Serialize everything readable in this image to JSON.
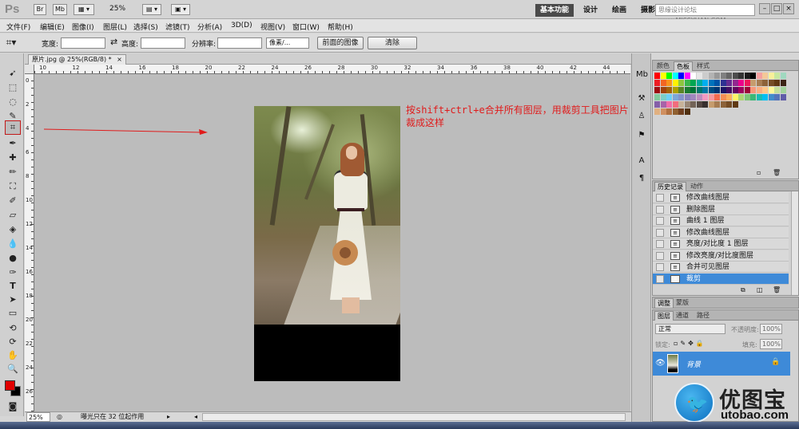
{
  "app": {
    "logo": "Ps",
    "top_buttons": [
      "Br",
      "Mb"
    ],
    "zoom_select": "25%",
    "workspaces": [
      "基本功能",
      "设计",
      "绘画",
      "摄影"
    ],
    "watermark_text": "思缘设计论坛 www.MISSYUAN.COM",
    "window_buttons": [
      "–",
      "□",
      "×"
    ]
  },
  "menu": [
    "文件(F)",
    "编辑(E)",
    "图像(I)",
    "图层(L)",
    "选择(S)",
    "滤镜(T)",
    "分析(A)",
    "3D(D)",
    "视图(V)",
    "窗口(W)",
    "帮助(H)"
  ],
  "options": {
    "width_label": "宽度:",
    "height_label": "高度:",
    "resolution_label": "分辨率:",
    "unit_select": "像素/...",
    "front_image_button": "前面的图像",
    "clear_button": "清除",
    "swap_symbol": "⇄"
  },
  "document": {
    "tab_title": "原片.jpg @ 25%(RGB/8) *",
    "close": "×",
    "annotation": "按shift+ctrl+e合并所有图层，用裁剪工具把图片裁成这样"
  },
  "ruler_top_labels": [
    "10",
    "12",
    "14",
    "16",
    "18",
    "20",
    "22",
    "24",
    "26",
    "28",
    "30",
    "32",
    "34",
    "36",
    "38",
    "40",
    "42",
    "44"
  ],
  "ruler_left_labels": [
    "0",
    "2",
    "4",
    "6",
    "8",
    "10",
    "12",
    "14",
    "16",
    "18",
    "20",
    "22",
    "24",
    "26"
  ],
  "status": {
    "zoom": "25%",
    "message": "曝光只在 32 位起作用"
  },
  "panels": {
    "swatch_tabs": [
      "颜色",
      "色板",
      "样式"
    ],
    "history_tabs": [
      "历史记录",
      "动作"
    ],
    "history_items": [
      {
        "label": "修改曲线图层"
      },
      {
        "label": "删除图层"
      },
      {
        "label": "曲线 1 图层"
      },
      {
        "label": "修改曲线图层"
      },
      {
        "label": "亮度/对比度 1 图层"
      },
      {
        "label": "修改亮度/对比度图层"
      },
      {
        "label": "合并可见图层"
      },
      {
        "label": "裁剪"
      }
    ],
    "adjust_tabs": [
      "调整",
      "蒙版"
    ],
    "layer_tabs": [
      "图层",
      "通道",
      "路径"
    ],
    "blend_mode": "正常",
    "opacity_label": "不透明度:",
    "opacity_value": "100%",
    "lock_label": "锁定:",
    "fill_label": "填充:",
    "fill_value": "100%",
    "layer_name": "背景"
  },
  "brand": {
    "cn": "优图宝",
    "en": "utobao.com"
  },
  "colors": {
    "accent_red": "#e01b1b",
    "selection_blue": "#3e8ad8",
    "foreground": "#e00000",
    "background": "#000000"
  }
}
